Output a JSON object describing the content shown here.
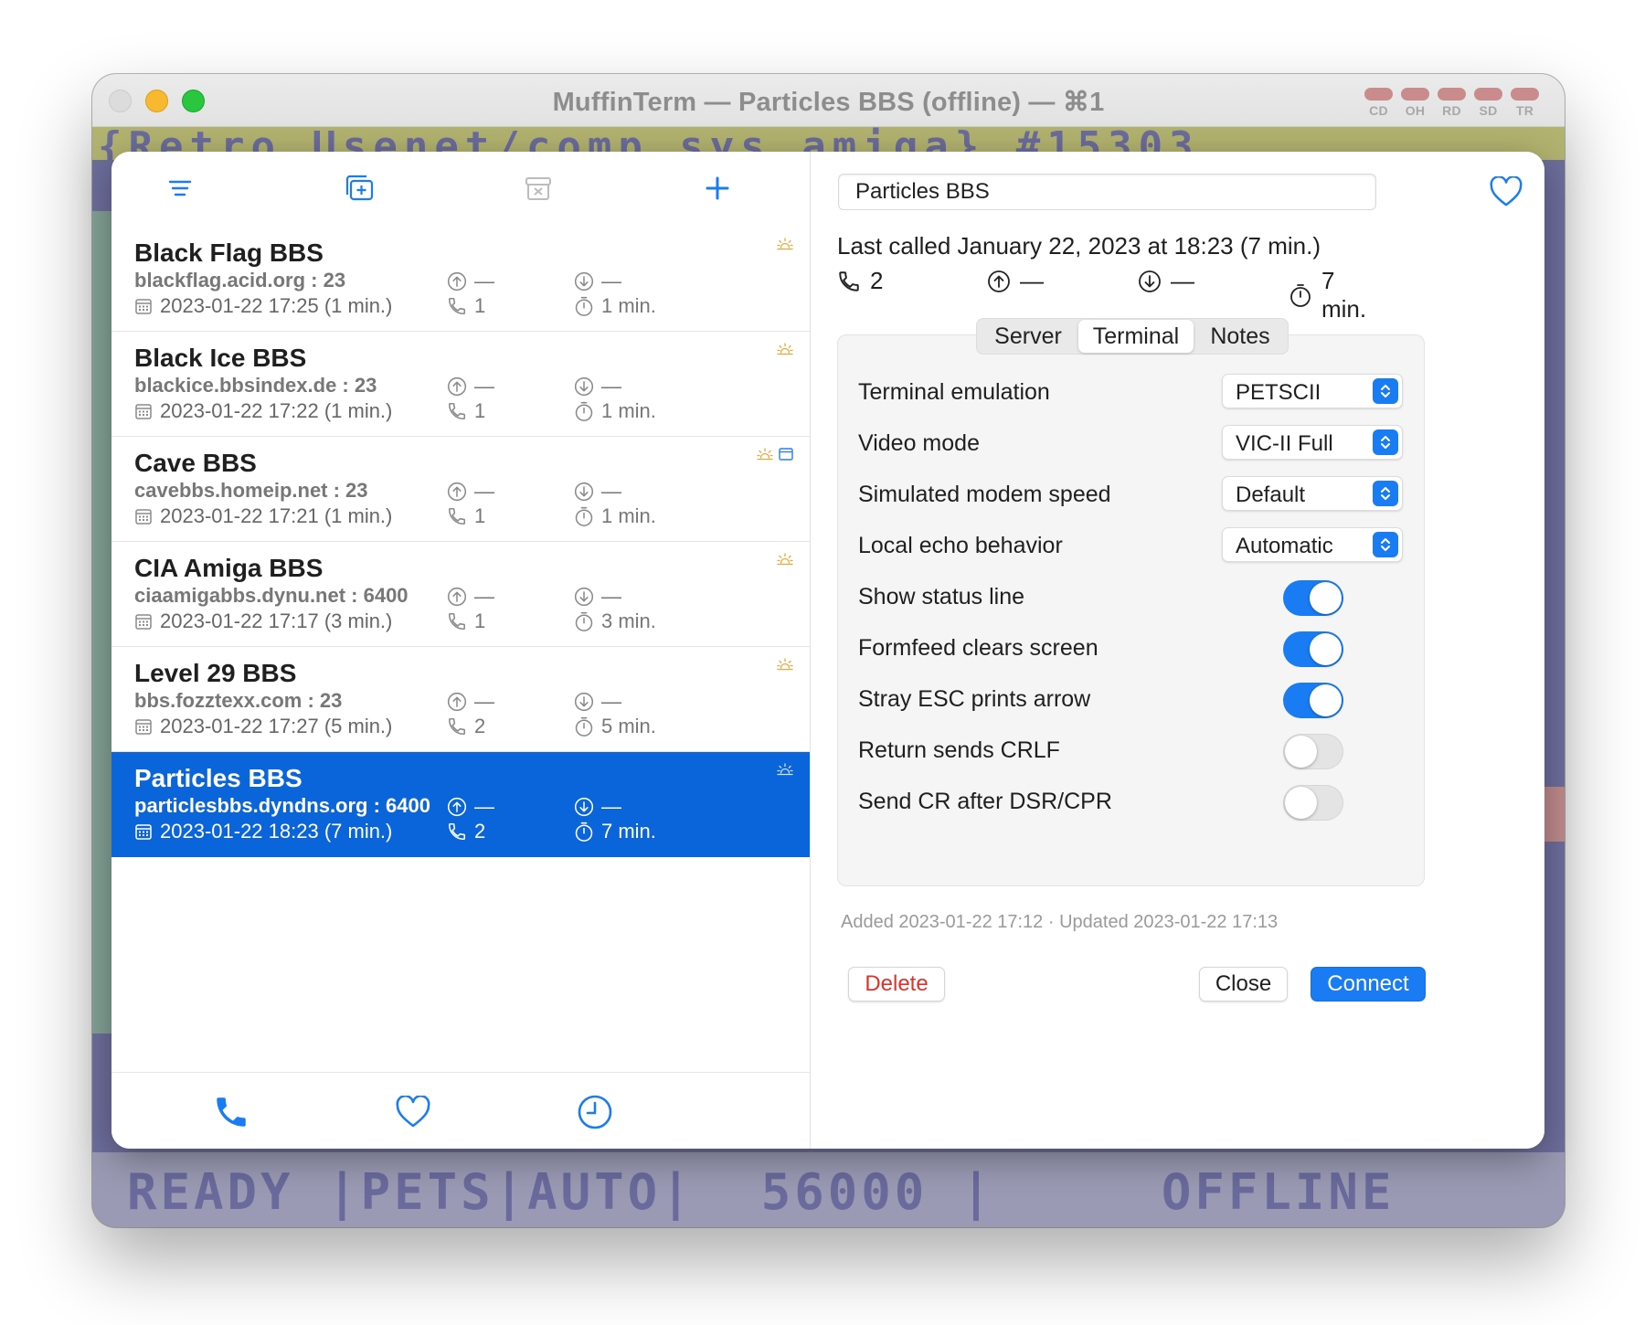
{
  "window": {
    "title": "MuffinTerm — Particles BBS (offline) — ⌘1",
    "leds": [
      "CD",
      "OH",
      "RD",
      "SD",
      "TR"
    ]
  },
  "terminal": {
    "top_line": "{Retro Usenet/comp.sys.amiga} #15303",
    "status_line": "READY |PETS|AUTO|  56000 |     OFFLINE"
  },
  "toolbar": {
    "icons": [
      "sort-lines-icon",
      "duplicate-icon",
      "archive-icon",
      "plus-icon"
    ]
  },
  "bbs_list": [
    {
      "name": "Black Flag BBS",
      "host": "blackflag.acid.org : 23",
      "date": "2023-01-22 17:25 (1 min.)",
      "up": "—",
      "down": "—",
      "calls": "1",
      "duration": "1 min.",
      "badges": [
        "sun-icon"
      ],
      "selected": false
    },
    {
      "name": "Black Ice BBS",
      "host": "blackice.bbsindex.de : 23",
      "date": "2023-01-22 17:22 (1 min.)",
      "up": "—",
      "down": "—",
      "calls": "1",
      "duration": "1 min.",
      "badges": [
        "sun-icon"
      ],
      "selected": false
    },
    {
      "name": "Cave BBS",
      "host": "cavebbs.homeip.net : 23",
      "date": "2023-01-22 17:21 (1 min.)",
      "up": "—",
      "down": "—",
      "calls": "1",
      "duration": "1 min.",
      "badges": [
        "sun-icon",
        "window-icon"
      ],
      "selected": false
    },
    {
      "name": "CIA Amiga BBS",
      "host": "ciaamigabbs.dynu.net : 6400",
      "date": "2023-01-22 17:17 (3 min.)",
      "up": "—",
      "down": "—",
      "calls": "1",
      "duration": "3 min.",
      "badges": [
        "sun-icon"
      ],
      "selected": false
    },
    {
      "name": "Level 29 BBS",
      "host": "bbs.fozztexx.com : 23",
      "date": "2023-01-22 17:27 (5 min.)",
      "up": "—",
      "down": "—",
      "calls": "2",
      "duration": "5 min.",
      "badges": [
        "sun-icon"
      ],
      "selected": false
    },
    {
      "name": "Particles BBS",
      "host": "particlesbbs.dyndns.org : 6400",
      "date": "2023-01-22 18:23 (7 min.)",
      "up": "—",
      "down": "—",
      "calls": "2",
      "duration": "7 min.",
      "badges": [
        "sun-icon"
      ],
      "selected": true
    }
  ],
  "bottom_bar": {
    "icons": [
      "phone-icon",
      "heart-icon",
      "clock-icon"
    ]
  },
  "detail": {
    "name": "Particles BBS",
    "last_called": "Last called January 22, 2023 at 18:23 (7 min.)",
    "stats": {
      "calls": "2",
      "up": "—",
      "down": "—",
      "duration": "7 min."
    },
    "tabs": [
      "Server",
      "Terminal",
      "Notes"
    ],
    "active_tab": "Terminal",
    "settings": [
      {
        "label": "Terminal emulation",
        "type": "popup",
        "value": "PETSCII"
      },
      {
        "label": "Video mode",
        "type": "popup",
        "value": "VIC-II Full"
      },
      {
        "label": "Simulated modem speed",
        "type": "popup",
        "value": "Default"
      },
      {
        "label": "Local echo behavior",
        "type": "popup",
        "value": "Automatic"
      },
      {
        "label": "Show status line",
        "type": "toggle",
        "on": true
      },
      {
        "label": "Formfeed clears screen",
        "type": "toggle",
        "on": true
      },
      {
        "label": "Stray ESC prints arrow",
        "type": "toggle",
        "on": true
      },
      {
        "label": "Return sends CRLF",
        "type": "toggle",
        "on": false
      },
      {
        "label": "Send CR after DSR/CPR",
        "type": "toggle",
        "on": false
      }
    ],
    "meta": "Added 2023-01-22 17:12 · Updated 2023-01-22 17:13",
    "buttons": {
      "delete": "Delete",
      "close": "Close",
      "connect": "Connect"
    }
  },
  "colors": {
    "accent": "#1a7cf2",
    "selection": "#0a64da",
    "destructive": "#e0312b",
    "badge_sun": "#e8a838"
  }
}
